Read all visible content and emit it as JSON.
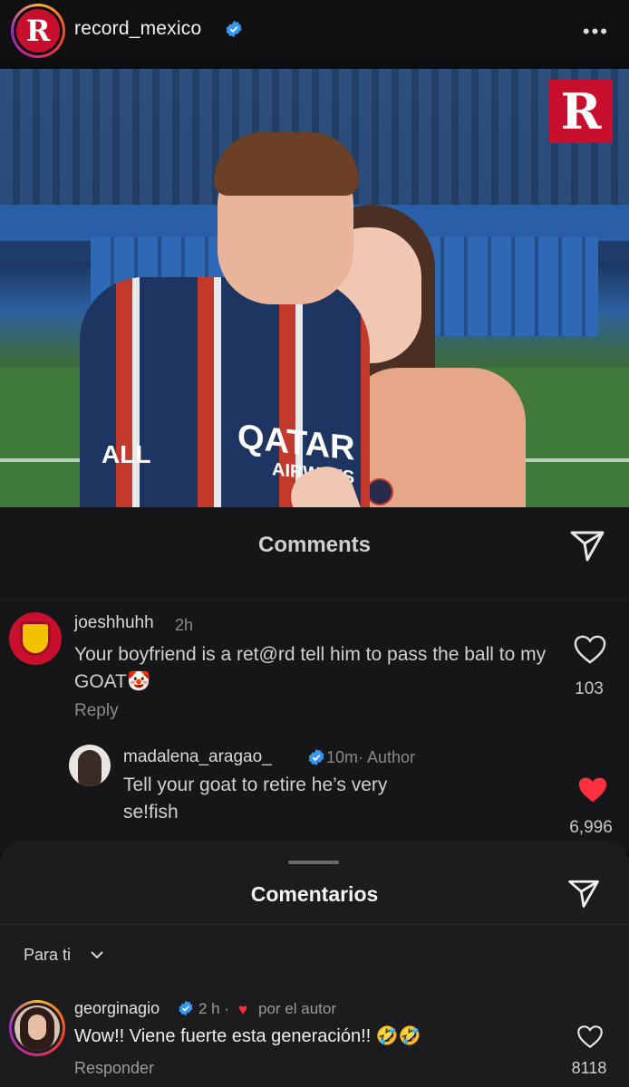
{
  "post": {
    "username": "record_mexico",
    "avatar_letter": "R",
    "watermark_letter": "R",
    "more_label": "•••",
    "photo_shirt_text": "QATAR",
    "photo_shirt_subtext": "AIRWAYS",
    "photo_sleeve_text": "ALL"
  },
  "comments_panel": {
    "title": "Comments",
    "comment": {
      "username": "joeshhuhh",
      "time": "2h",
      "text": "Your boyfriend is a ret@rd tell him to pass the ball to my GOAT🤡",
      "reply_label": "Reply",
      "likes": "103"
    },
    "reply": {
      "username": "madalena_aragao_",
      "meta": "10m· Author",
      "text": "Tell your goat to retire he’s very se!fish",
      "likes": "6,996",
      "liked": true
    }
  },
  "sheet": {
    "title": "Comentarios",
    "sort_label": "Para ti",
    "comment": {
      "username": "georginagio",
      "time": "2 h ·",
      "author_label": "por el autor",
      "text": "Wow!! Viene fuerte esta generación!! 🤣🤣",
      "reply_label": "Responder",
      "likes": "8118"
    }
  },
  "colors": {
    "verified": "#3897f0",
    "liked_heart": "#ff3040",
    "brand_red": "#c8102e"
  }
}
